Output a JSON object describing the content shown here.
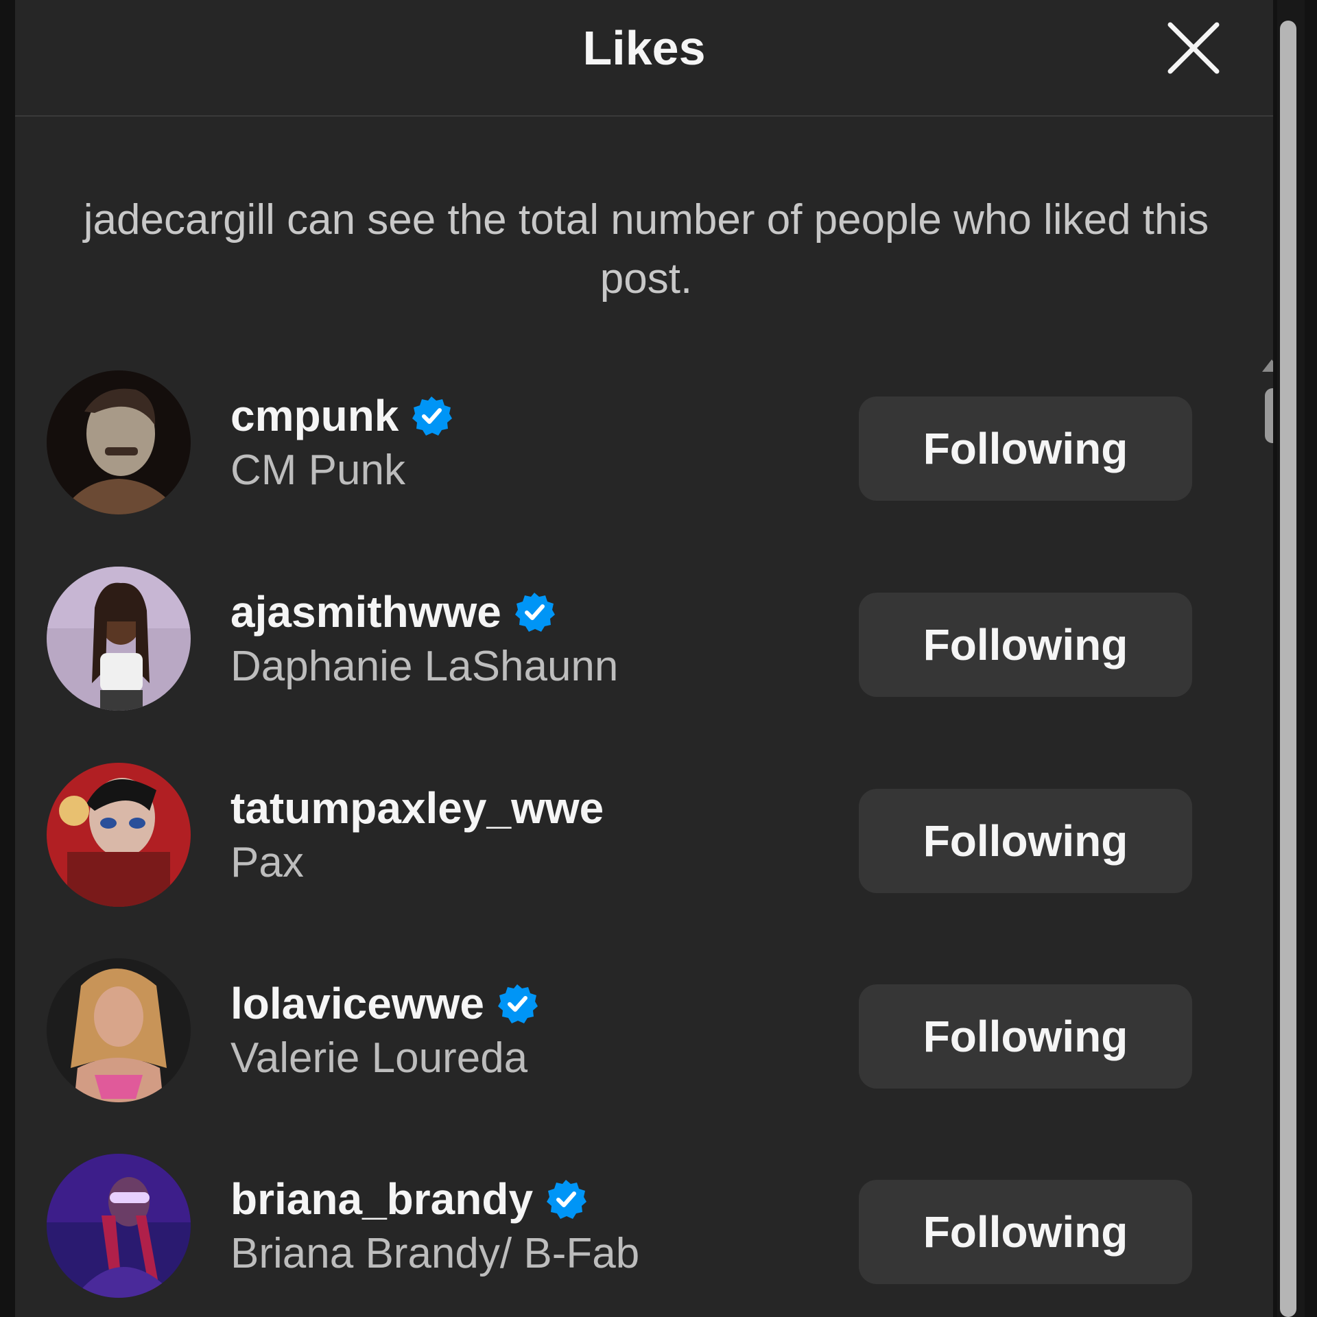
{
  "dialog": {
    "title": "Likes",
    "close_icon": "close-icon",
    "notice": "jadecargill can see the total number of people who liked this post."
  },
  "users": [
    {
      "username": "cmpunk",
      "fullname": "CM Punk",
      "verified": true,
      "button": "Following"
    },
    {
      "username": "ajasmithwwe",
      "fullname": "Daphanie LaShaunn",
      "verified": true,
      "button": "Following"
    },
    {
      "username": "tatumpaxley_wwe",
      "fullname": "Pax",
      "verified": false,
      "button": "Following"
    },
    {
      "username": "lolavicewwe",
      "fullname": "Valerie Loureda",
      "verified": true,
      "button": "Following"
    },
    {
      "username": "briana_brandy",
      "fullname": "Briana Brandy/ B-Fab",
      "verified": true,
      "button": "Following"
    }
  ],
  "colors": {
    "background": "#262626",
    "button": "#363636",
    "verified_badge": "#0095f6",
    "primary_text": "#f5f5f5",
    "secondary_text": "#bdbdbd"
  }
}
